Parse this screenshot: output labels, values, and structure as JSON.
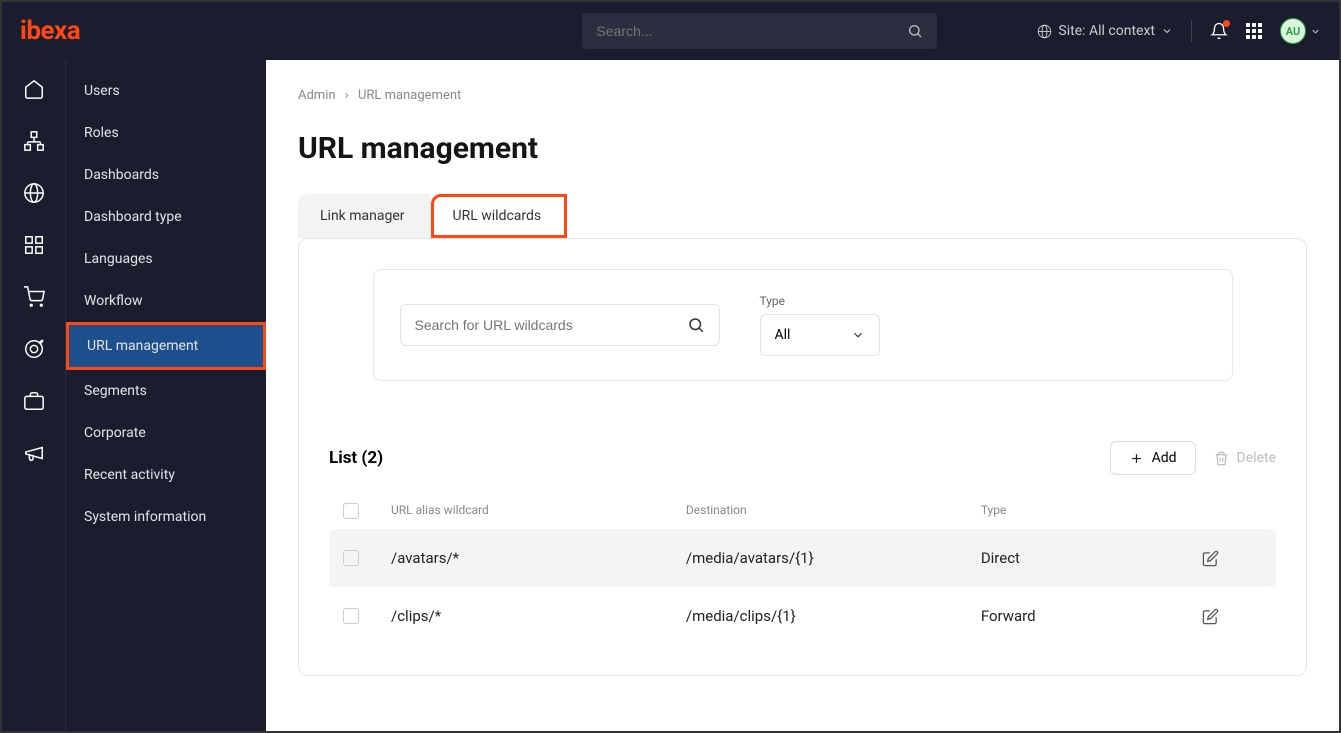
{
  "topbar": {
    "logo": "ibexa",
    "search_placeholder": "Search...",
    "site_context": "Site: All context",
    "avatar_initials": "AU"
  },
  "sidebar": {
    "items": [
      {
        "label": "Users"
      },
      {
        "label": "Roles"
      },
      {
        "label": "Dashboards"
      },
      {
        "label": "Dashboard type"
      },
      {
        "label": "Languages"
      },
      {
        "label": "Workflow"
      },
      {
        "label": "URL management"
      },
      {
        "label": "Segments"
      },
      {
        "label": "Corporate"
      },
      {
        "label": "Recent activity"
      },
      {
        "label": "System information"
      }
    ]
  },
  "breadcrumb": {
    "root": "Admin",
    "current": "URL management"
  },
  "page": {
    "title": "URL management"
  },
  "tabs": {
    "link_manager": "Link manager",
    "url_wildcards": "URL wildcards"
  },
  "filter": {
    "search_placeholder": "Search for URL wildcards",
    "type_label": "Type",
    "type_value": "All"
  },
  "list": {
    "title": "List (2)",
    "add_label": "Add",
    "delete_label": "Delete",
    "columns": {
      "alias": "URL alias wildcard",
      "destination": "Destination",
      "type": "Type"
    },
    "rows": [
      {
        "alias": "/avatars/*",
        "destination": "/media/avatars/{1}",
        "type": "Direct"
      },
      {
        "alias": "/clips/*",
        "destination": "/media/clips/{1}",
        "type": "Forward"
      }
    ]
  }
}
